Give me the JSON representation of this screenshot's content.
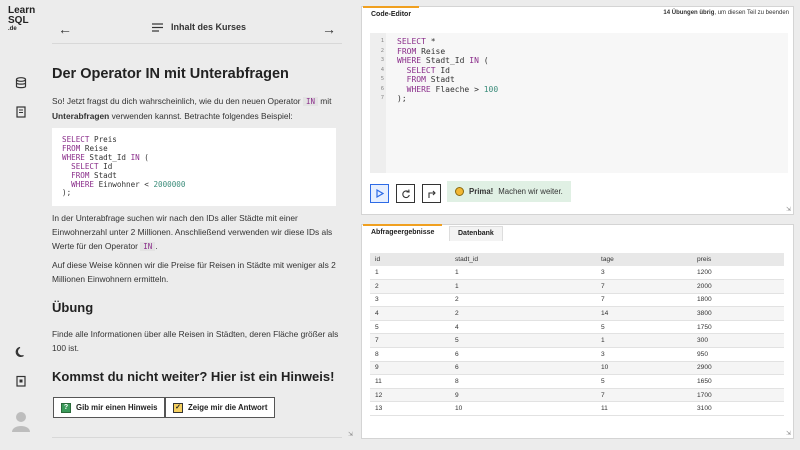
{
  "app": {
    "logo_line1": "Learn",
    "logo_line2": "SQL",
    "logo_line3": ".de"
  },
  "rail": {
    "icons": [
      "database-icon",
      "document-icon",
      "moon-icon",
      "clipboard-icon",
      "user-avatar-icon"
    ]
  },
  "lesson": {
    "nav_title": "Inhalt des Kurses",
    "title": "Der Operator IN mit Unterabfragen",
    "p1_a": "So! Jetzt fragst du dich wahrscheinlich, wie du den neuen Operator",
    "p1_kw": "IN",
    "p1_b": "mit",
    "p1_bold": "Unterabfragen",
    "p1_c": "verwenden kannst. Betrachte folgendes Beispiel:",
    "code": {
      "l1_kw": "SELECT",
      "l1_rest": " Preis",
      "l2_kw": "FROM",
      "l2_rest": " Reise",
      "l3_kw": "WHERE",
      "l3_mid": " Stadt_Id ",
      "l3_kw2": "IN",
      "l3_rest": " (",
      "l4_kw": "  SELECT",
      "l4_rest": " Id",
      "l5_kw": "  FROM",
      "l5_rest": " Stadt",
      "l6_kw": "  WHERE",
      "l6_mid": " Einwohner < ",
      "l6_num": "2000000",
      "l7": ");"
    },
    "p2_a": "In der Unterabfrage suchen wir nach den IDs aller Städte mit einer Einwohnerzahl unter 2 Millionen. Anschließend verwenden wir diese IDs als Werte für den Operator",
    "p2_kw": "IN",
    "p2_end": ".",
    "p3": "Auf diese Weise können wir die Preise für Reisen in Städte mit weniger als 2 Millionen Einwohnern ermitteln.",
    "exercise_heading": "Übung",
    "exercise_text": "Finde alle Informationen über alle Reisen in Städten, deren Fläche größer als 100 ist.",
    "hint_heading": "Kommst du nicht weiter? Hier ist ein Hinweis!",
    "hint_button": "Gib mir einen Hinweis",
    "answer_button": "Zeige mir die Antwort"
  },
  "editor": {
    "tab_label": "Code-Editor",
    "hint_count": "14 Übungen übrig",
    "hint_rest": ", um diesen Teil zu beenden",
    "line_numbers": [
      "1",
      "2",
      "3",
      "4",
      "5",
      "6",
      "7"
    ],
    "code": {
      "l1_kw": "SELECT",
      "l1_rest": " *",
      "l2_kw": "FROM",
      "l2_rest": " Reise",
      "l3_kw": "WHERE",
      "l3_mid": " Stadt_Id ",
      "l3_kw2": "IN",
      "l3_rest": " (",
      "l4_kw": "  SELECT",
      "l4_rest": " Id",
      "l5_kw": "  FROM",
      "l5_rest": " Stadt",
      "l6_kw": "  WHERE",
      "l6_mid": " Flaeche > ",
      "l6_num": "100",
      "l7": ");"
    },
    "success_bold": "Prima!",
    "success_text": "Machen wir weiter."
  },
  "results": {
    "tab_results": "Abfrageergebnisse",
    "tab_database": "Datenbank",
    "columns": [
      "id",
      "stadt_id",
      "tage",
      "preis"
    ],
    "rows": [
      [
        "1",
        "1",
        "3",
        "1200"
      ],
      [
        "2",
        "1",
        "7",
        "2000"
      ],
      [
        "3",
        "2",
        "7",
        "1800"
      ],
      [
        "4",
        "2",
        "14",
        "3800"
      ],
      [
        "5",
        "4",
        "5",
        "1750"
      ],
      [
        "7",
        "5",
        "1",
        "300"
      ],
      [
        "8",
        "6",
        "3",
        "950"
      ],
      [
        "9",
        "6",
        "10",
        "2900"
      ],
      [
        "11",
        "8",
        "5",
        "1650"
      ],
      [
        "12",
        "9",
        "7",
        "1700"
      ],
      [
        "13",
        "10",
        "11",
        "3100"
      ]
    ]
  },
  "colors": {
    "keyword": "#8a2d8a",
    "number": "#3b8c7a",
    "tab_accent": "#f0a020",
    "run_blue": "#2d6be6",
    "success_bg": "#e0f0e4"
  }
}
